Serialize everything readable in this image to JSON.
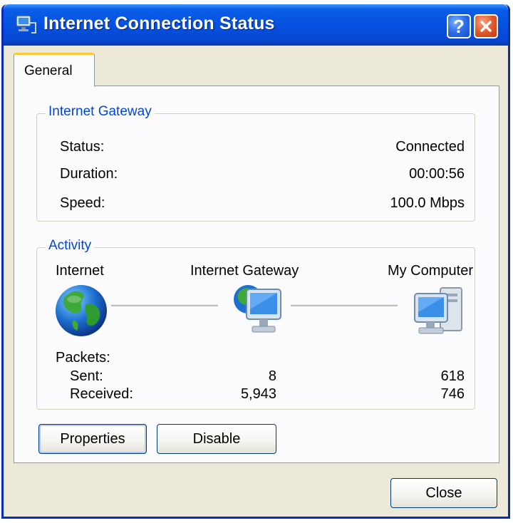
{
  "window": {
    "title": "Internet Connection Status"
  },
  "tabs": [
    {
      "label": "General"
    }
  ],
  "gateway": {
    "legend": "Internet Gateway",
    "rows": [
      {
        "label": "Status:",
        "value": "Connected"
      },
      {
        "label": "Duration:",
        "value": "00:00:56"
      },
      {
        "label": "Speed:",
        "value": "100.0 Mbps"
      }
    ]
  },
  "activity": {
    "legend": "Activity",
    "nodes": [
      {
        "label": "Internet",
        "icon": "globe-icon"
      },
      {
        "label": "Internet Gateway",
        "icon": "gateway-computer-icon"
      },
      {
        "label": "My Computer",
        "icon": "computer-icon"
      }
    ],
    "packets_label": "Packets:",
    "sent_label": "Sent:",
    "received_label": "Received:",
    "gateway_sent": "8",
    "gateway_received": "5,943",
    "computer_sent": "618",
    "computer_received": "746"
  },
  "buttons": {
    "properties": "Properties",
    "disable": "Disable",
    "close": "Close"
  },
  "colors": {
    "title_bar": "#0551e0",
    "legend_text": "#0046d5",
    "tab_highlight": "#ffc83c",
    "dialog_bg": "#ece9d8"
  }
}
